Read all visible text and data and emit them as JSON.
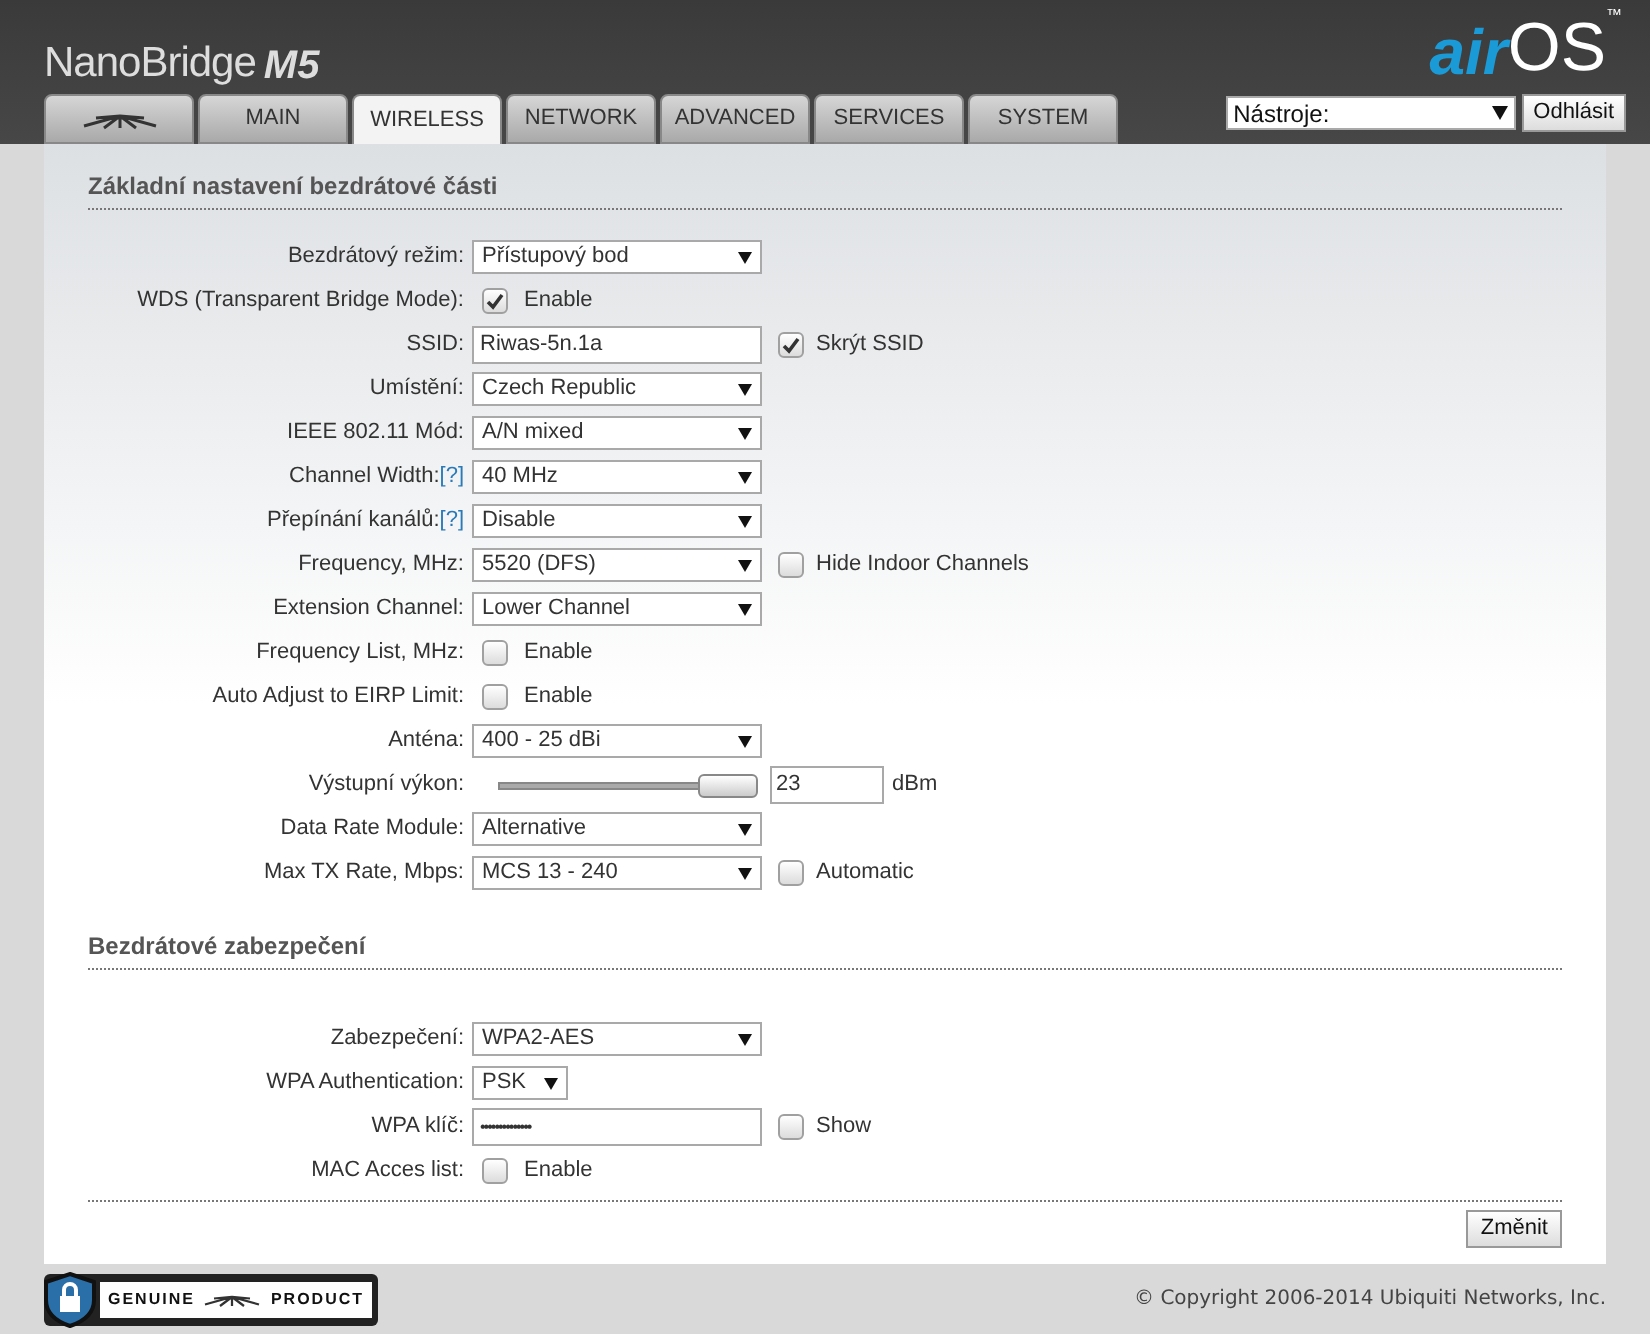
{
  "header": {
    "product": "NanoBridge",
    "model": "M5",
    "brand_air": "air",
    "brand_os": "OS",
    "tm": "™"
  },
  "tabs": [
    {
      "kind": "logo",
      "selected": false
    },
    {
      "kind": "text",
      "label": "MAIN",
      "selected": false
    },
    {
      "kind": "text",
      "label": "WIRELESS",
      "selected": true
    },
    {
      "kind": "text",
      "label": "NETWORK",
      "selected": false
    },
    {
      "kind": "text",
      "label": "ADVANCED",
      "selected": false
    },
    {
      "kind": "text",
      "label": "SERVICES",
      "selected": false
    },
    {
      "kind": "text",
      "label": "SYSTEM",
      "selected": false
    }
  ],
  "tools": {
    "value": "Nástroje:",
    "logout": "Odhlásit"
  },
  "sections": [
    {
      "title": "Základní nastavení bezdrátové části",
      "rows": [
        {
          "label": "Bezdrátový režim:",
          "kind": "select",
          "value": "Přístupový bod"
        },
        {
          "label": "WDS (Transparent Bridge Mode):",
          "kind": "check",
          "checked": true,
          "text": "Enable"
        },
        {
          "label": "SSID:",
          "kind": "text",
          "value": "Riwas-5n.1a",
          "extra": {
            "checked": true,
            "text": "Skrýt SSID"
          }
        },
        {
          "label": "Umístění:",
          "kind": "select",
          "value": "Czech Republic"
        },
        {
          "label": "IEEE 802.11 Mód:",
          "kind": "select",
          "value": "A/N mixed"
        },
        {
          "label": "Channel Width:",
          "help": "[?]",
          "kind": "select",
          "value": "40 MHz"
        },
        {
          "label": "Přepínání kanálů:",
          "help": "[?]",
          "kind": "select",
          "value": "Disable"
        },
        {
          "label": "Frequency, MHz:",
          "kind": "select",
          "value": "5520 (DFS)",
          "extra": {
            "checked": false,
            "text": "Hide Indoor Channels"
          }
        },
        {
          "label": "Extension Channel:",
          "kind": "select",
          "value": "Lower Channel"
        },
        {
          "label": "Frequency List, MHz:",
          "kind": "check",
          "checked": false,
          "text": "Enable"
        },
        {
          "label": "Auto Adjust to EIRP Limit:",
          "kind": "check",
          "checked": false,
          "text": "Enable"
        },
        {
          "label": "Anténa:",
          "kind": "select",
          "value": "400 - 25 dBi"
        },
        {
          "label": "Výstupní výkon:",
          "kind": "slider",
          "level": 1,
          "value": "23",
          "unit": "dBm"
        },
        {
          "label": "Data Rate Module:",
          "kind": "select",
          "value": "Alternative"
        },
        {
          "label": "Max TX Rate, Mbps:",
          "kind": "select",
          "value": "MCS 13 - 240",
          "extra": {
            "checked": false,
            "text": "Automatic"
          }
        }
      ]
    },
    {
      "title": "Bezdrátové zabezpečení",
      "rows": [
        {
          "label": "Zabezpečení:",
          "kind": "select",
          "value": "WPA2-AES"
        },
        {
          "label": "WPA Authentication:",
          "kind": "smallselect",
          "value": "PSK"
        },
        {
          "label": "WPA klíč:",
          "kind": "password",
          "value": "••••••••••••••",
          "extra": {
            "checked": false,
            "text": "Show"
          }
        },
        {
          "label": "MAC Acces list:",
          "kind": "check",
          "checked": false,
          "text": "Enable"
        }
      ]
    }
  ],
  "submit": "Změnit",
  "footer": {
    "badge_left": "GENUINE",
    "badge_right": "PRODUCT",
    "copyright": "© Copyright 2006-2014 Ubiquiti Networks, Inc."
  }
}
